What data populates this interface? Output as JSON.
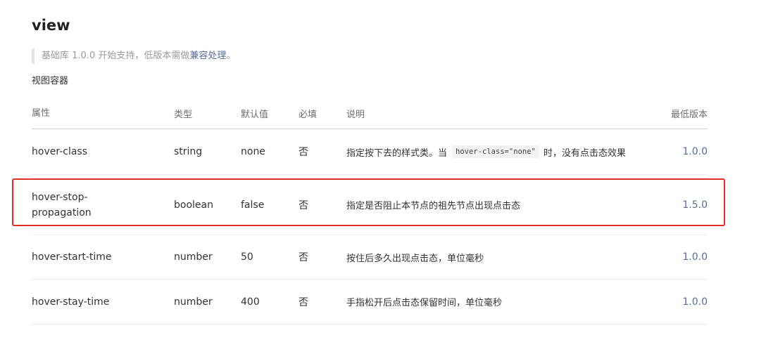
{
  "title": "view",
  "note": {
    "prefix": "基础库 1.0.0 开始支持，低版本需做",
    "link": "兼容处理",
    "suffix": "。"
  },
  "description": "视图容器",
  "table": {
    "headers": {
      "name": "属性",
      "type": "类型",
      "default": "默认值",
      "required": "必填",
      "desc": "说明",
      "version": "最低版本"
    },
    "rows": [
      {
        "name": "hover-class",
        "type": "string",
        "default": "none",
        "required": "否",
        "desc_before": "指定按下去的样式类。当",
        "desc_code": "hover-class=\"none\"",
        "desc_after": "时，没有点击态效果",
        "version": "1.0.0"
      },
      {
        "name": "hover-stop-propagation",
        "name_line1": "hover-stop-",
        "name_line2": "propagation",
        "type": "boolean",
        "default": "false",
        "required": "否",
        "desc": "指定是否阻止本节点的祖先节点出现点击态",
        "version": "1.5.0"
      },
      {
        "name": "hover-start-time",
        "type": "number",
        "default": "50",
        "required": "否",
        "desc": "按住后多久出现点击态，单位毫秒",
        "version": "1.0.0"
      },
      {
        "name": "hover-stay-time",
        "type": "number",
        "default": "400",
        "required": "否",
        "desc": "手指松开后点击态保留时间，单位毫秒",
        "version": "1.0.0"
      }
    ]
  },
  "colors": {
    "link": "#576b95",
    "highlight": "#e0302a"
  }
}
